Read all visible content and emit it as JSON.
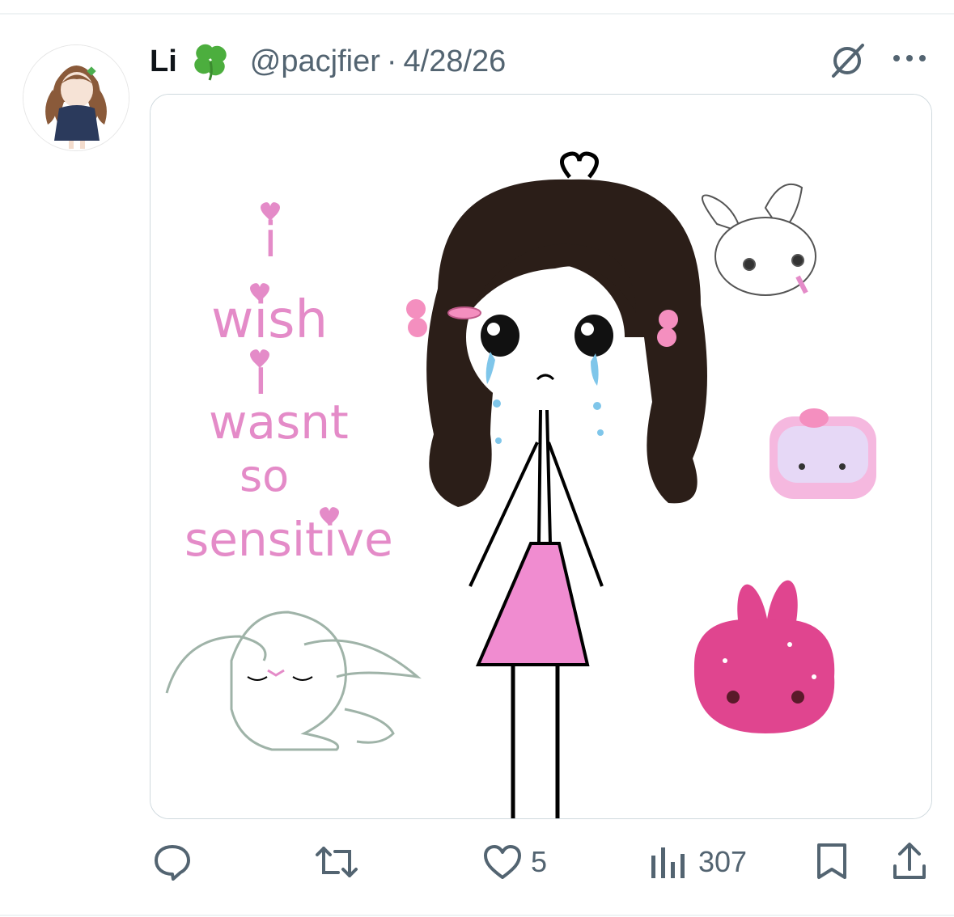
{
  "post": {
    "author_name": "Li",
    "author_emoji": "clover-emoji",
    "handle": "@pacjfier",
    "separator": "·",
    "date": "4/28/26"
  },
  "image_text": {
    "line1": "i",
    "line2": "wish",
    "line3": "i",
    "line4": "wasnt",
    "line5": "so",
    "line6": "sensitive"
  },
  "actions": {
    "reply_count": "",
    "repost_count": "",
    "like_count": "5",
    "views_count": "307"
  },
  "colors": {
    "text_primary": "#0f1419",
    "text_secondary": "#536471",
    "handwriting_pink": "#e48bc8",
    "dress_pink": "#f08cd0",
    "hair_brown": "#2b1e18"
  },
  "icons": [
    "clover-emoji",
    "grok-icon",
    "more-icon",
    "reply-icon",
    "repost-icon",
    "like-icon",
    "views-icon",
    "bookmark-icon",
    "share-icon"
  ]
}
